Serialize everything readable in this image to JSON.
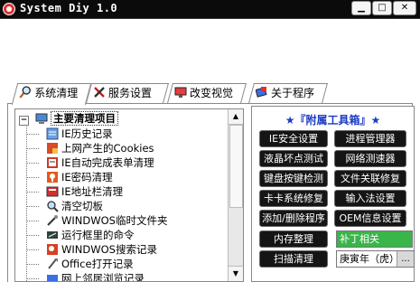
{
  "window": {
    "title": "System Diy 1.0",
    "min_label": "▁",
    "max_label": "□",
    "close_label": "✕"
  },
  "tabs": [
    {
      "label": "系统清理",
      "icon": "magnifier-icon"
    },
    {
      "label": "服务设置",
      "icon": "tools-icon"
    },
    {
      "label": "改变视觉",
      "icon": "display-icon"
    },
    {
      "label": "关于程序",
      "icon": "info-icon"
    }
  ],
  "tree": {
    "root_expander": "−",
    "root_label": "主要清理项目",
    "items": [
      {
        "label": "IE历史记录",
        "icon": "history-icon"
      },
      {
        "label": "上网产生的Cookies",
        "icon": "cookies-icon"
      },
      {
        "label": "IE自动完成表单清理",
        "icon": "form-icon"
      },
      {
        "label": "IE密码清理",
        "icon": "password-icon"
      },
      {
        "label": "IE地址栏清理",
        "icon": "address-bar-icon"
      },
      {
        "label": "清空切板",
        "icon": "clipboard-icon"
      },
      {
        "label": "WINDWOS临时文件夹",
        "icon": "temp-folder-icon"
      },
      {
        "label": "运行框里的命令",
        "icon": "run-icon"
      },
      {
        "label": "WINDWOS搜索记录",
        "icon": "search-history-icon"
      },
      {
        "label": "Office打开记录",
        "icon": "office-icon"
      },
      {
        "label": "网上邻居浏览记录",
        "icon": "network-icon"
      }
    ],
    "scroll_up": "▲",
    "scroll_down": "▼"
  },
  "tools": {
    "title": "★『附属工具箱』★",
    "buttons": [
      {
        "label": "IE安全设置"
      },
      {
        "label": "进程管理器"
      },
      {
        "label": "液晶坏点测试"
      },
      {
        "label": "网络测速器"
      },
      {
        "label": "键盘按键检测"
      },
      {
        "label": "文件关联修复"
      },
      {
        "label": "卡卡系统修复"
      },
      {
        "label": "输入法设置"
      },
      {
        "label": "添加/删除程序"
      },
      {
        "label": "OEM信息设置"
      },
      {
        "label": "内存整理"
      },
      {
        "label": "扫描清理"
      }
    ],
    "patch_field": "补丁相关",
    "year_combo": "庚寅年（虎）",
    "combo_arrow": "..."
  },
  "colors": {
    "titlebar": "#0b0b0b",
    "tool_button": "#151515",
    "patch_field": "#3ab54a",
    "tools_title": "#1a3bc4"
  }
}
